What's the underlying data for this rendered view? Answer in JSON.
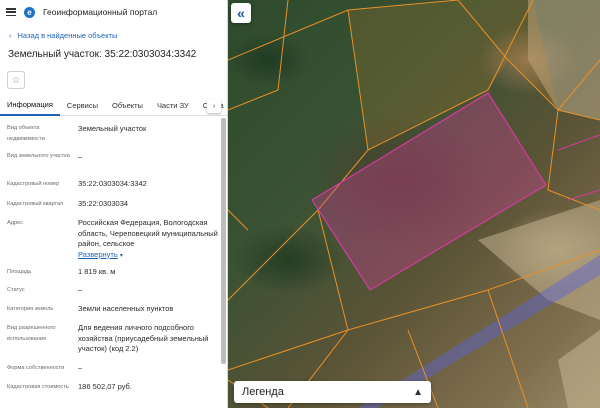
{
  "app": {
    "title": "Геоинформационный портал",
    "logo_letter": "e"
  },
  "nav": {
    "back_label": "Назад в найденные объекты"
  },
  "object": {
    "title": "Земельный участок: 35:22:0303034:3342"
  },
  "tabs": [
    {
      "label": "Информация",
      "active": true
    },
    {
      "label": "Сервисы"
    },
    {
      "label": "Объекты"
    },
    {
      "label": "Части ЗУ"
    },
    {
      "label": "Соста"
    }
  ],
  "properties": [
    {
      "label": "Вид объекта недвижимости",
      "value": "Земельный участок"
    },
    {
      "label": "Вид земельного участка",
      "value": "–"
    },
    {
      "label": "Кадастровый номер",
      "value": "35:22:0303034:3342"
    },
    {
      "label": "Кадастровый квартал",
      "value": "35:22:0303034"
    },
    {
      "label": "Адрес",
      "value": "Российская Федерация, Вологодская область, Череповецкий муниципальный район, сельское",
      "expand_label": "Развернуть"
    },
    {
      "label": "Площадь",
      "value": "1 819 кв. м"
    },
    {
      "label": "Статус",
      "value": "–"
    },
    {
      "label": "Категория земель",
      "value": "Земли населенных пунктов"
    },
    {
      "label": "Вид разрешенного использования",
      "value": "Для ведения личного подсобного хозяйства (приусадебный земельный участок) (код 2.2)"
    },
    {
      "label": "Форма собственности",
      "value": "–"
    },
    {
      "label": "Кадастровая стоимость",
      "value": "186 502,07 руб."
    }
  ],
  "map": {
    "legend_label": "Легенда",
    "colors": {
      "parcel_outline": "#e8912a",
      "selected_fill": "#d23c9c",
      "zone": "#5a63d8"
    }
  }
}
